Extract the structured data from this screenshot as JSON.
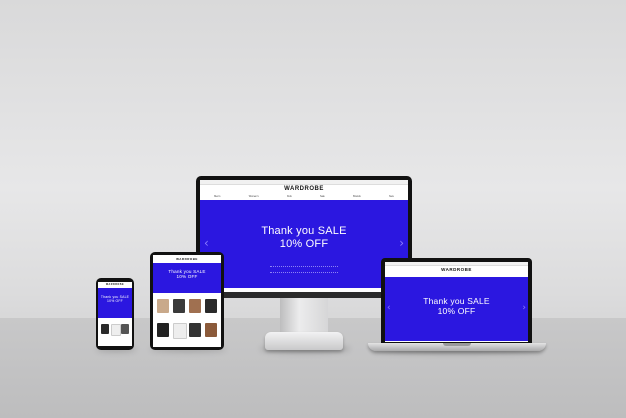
{
  "brand": {
    "logo": "WARDROBE",
    "accent": "#2b17e0"
  },
  "promo": {
    "line1": "Thank you SALE",
    "line2": "10% OFF"
  },
  "nav": {
    "items": [
      "Men's",
      "Women's",
      "Kids",
      "Sale",
      "Brands",
      "New"
    ]
  },
  "icons": {
    "prev": "‹",
    "next": "›"
  },
  "colors": {
    "hero": "#2b17e0",
    "bezel": "#111111",
    "background": "#dedede"
  }
}
